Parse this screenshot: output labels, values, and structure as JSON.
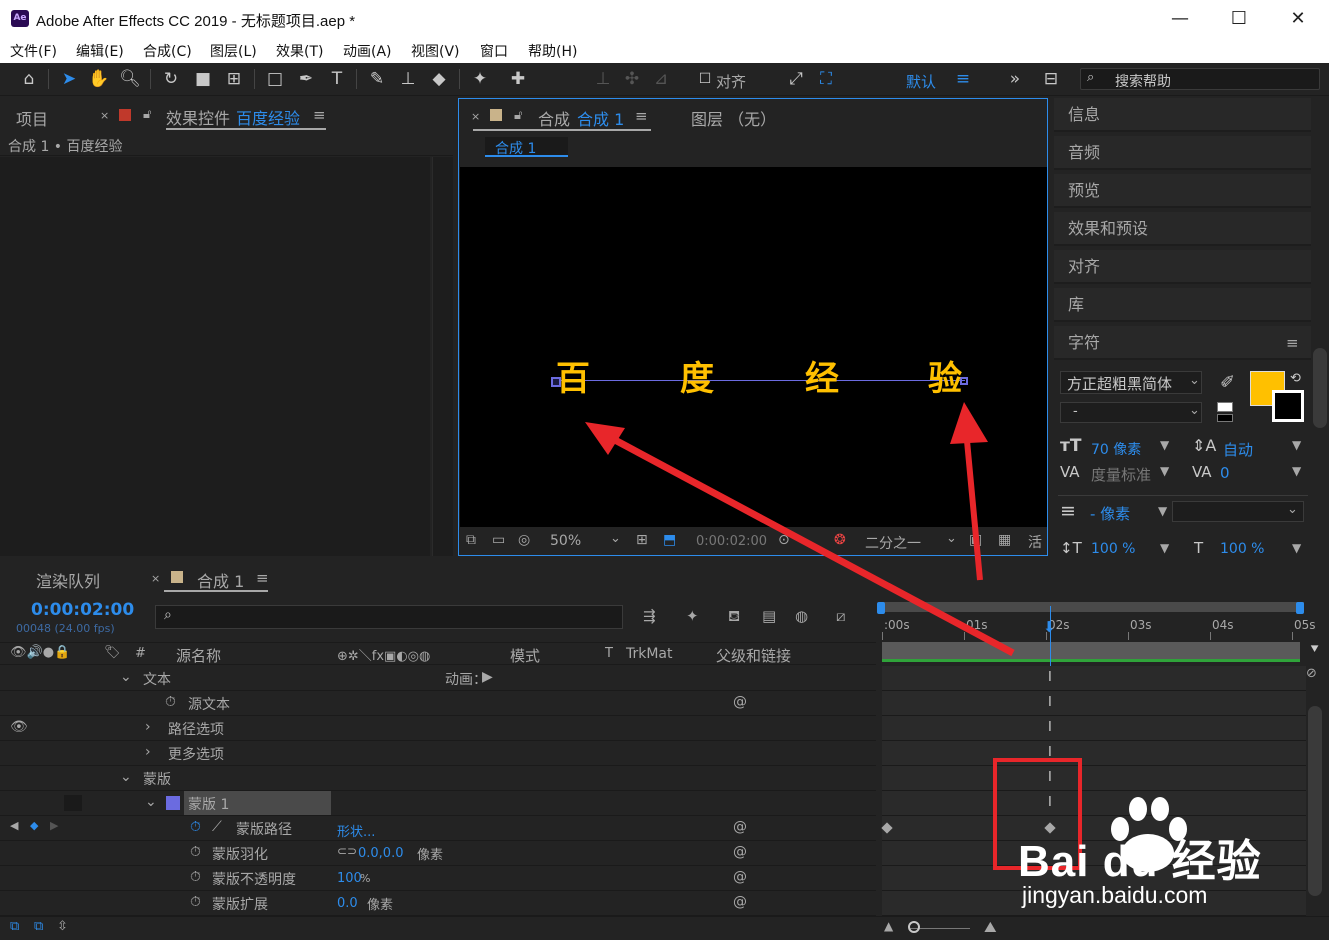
{
  "window": {
    "logo": "Ae",
    "title": "Adobe After Effects CC 2019 - 无标题项目.aep *",
    "minimize": "—",
    "maximize": "☐",
    "close": "✕"
  },
  "menu": [
    "文件(F)",
    "编辑(E)",
    "合成(C)",
    "图层(L)",
    "效果(T)",
    "动画(A)",
    "视图(V)",
    "窗口",
    "帮助(H)"
  ],
  "toolbar": {
    "align_label": "对齐",
    "workspace": "默认",
    "search_placeholder": "搜索帮助"
  },
  "left_panel": {
    "tab_project": "项目",
    "tab_effects_prefix": "效果控件",
    "tab_effects_layer": "百度经验",
    "breadcrumb": "合成 1 • 百度经验"
  },
  "comp_panel": {
    "tab_prefix": "合成",
    "tab_name": "合成 1",
    "tab_layer": "图层 （无）",
    "crumb": "合成 1",
    "text_chars": [
      "百",
      "度",
      "经",
      "验"
    ],
    "zoom": "50%",
    "timecode": "0:00:02:00",
    "resolution": "二分之一",
    "active_cam": "活"
  },
  "right_panel": {
    "items": [
      "信息",
      "音频",
      "预览",
      "效果和预设",
      "对齐",
      "库"
    ],
    "character_title": "字符",
    "font_family": "方正超粗黑简体",
    "font_style": "-",
    "font_size": "70 像素",
    "leading": "自动",
    "kerning": "度量标准",
    "tracking": "0",
    "stroke_width": "- 像素",
    "vscale": "100 %",
    "hscale": "100 %",
    "fill_color": "#ffc000"
  },
  "timeline": {
    "tab_render": "渲染队列",
    "tab_comp": "合成 1",
    "timecode": "0:00:02:00",
    "frames": "00048 (24.00 fps)",
    "col_source": "源名称",
    "col_mode": "模式",
    "col_t": "T",
    "col_trkmat": "TrkMat",
    "col_parent": "父级和链接",
    "ruler": [
      ":00s",
      "01s",
      "02s",
      "03s",
      "04s",
      "05s"
    ],
    "current_time_seconds": 2,
    "rows": [
      {
        "label": "文本",
        "extra": "动画："
      },
      {
        "label": "源文本"
      },
      {
        "label": "路径选项"
      },
      {
        "label": "更多选项"
      },
      {
        "label": "蒙版"
      },
      {
        "label": "蒙版 1",
        "num": "1"
      },
      {
        "label": "蒙版路径",
        "value": "形状..."
      },
      {
        "label": "蒙版羽化",
        "value": "0.0,0.0",
        "unit": "像素"
      },
      {
        "label": "蒙版不透明度",
        "value": "100",
        "unit": "%"
      },
      {
        "label": "蒙版扩展",
        "value": "0.0",
        "unit": "像素"
      }
    ]
  },
  "watermark": {
    "brand": "Bai du 经验",
    "url": "jingyan.baidu.com"
  },
  "colors": {
    "accent": "#2d8ceb",
    "annotation_red": "#e8262a",
    "text_yellow": "#ffc000",
    "mask_color": "#6b6be0"
  }
}
